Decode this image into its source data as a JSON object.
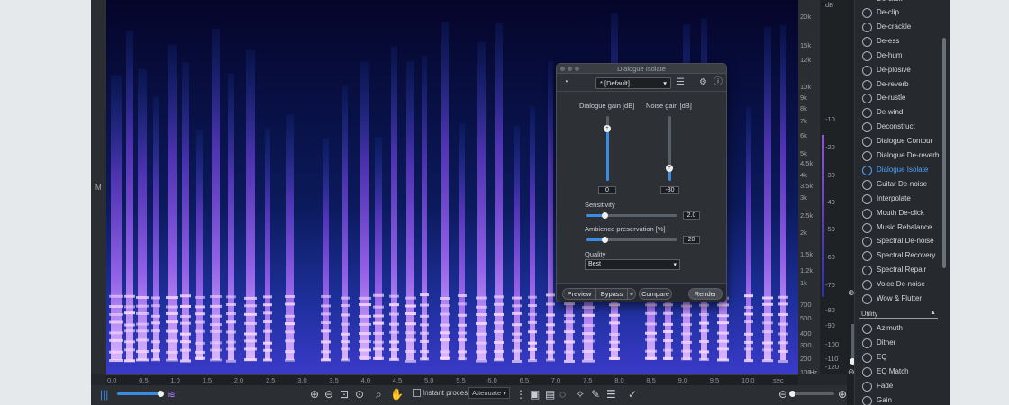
{
  "spectrogram": {
    "channel_label": "M",
    "freq_ticks": [
      "20k",
      "15k",
      "12k",
      "10k",
      "9k",
      "8k",
      "7k",
      "6k",
      "5k",
      "4.5k",
      "4k",
      "3.5k",
      "3k",
      "2.5k",
      "2k",
      "1.5k",
      "1.2k",
      "1k",
      "700",
      "500",
      "400",
      "300",
      "200",
      "100",
      "Hz"
    ],
    "db_ticks": [
      "dB",
      "-10",
      "-20",
      "-30",
      "-40",
      "-50",
      "-60",
      "-70",
      "-80",
      "-90",
      "-100",
      "-110",
      "-120"
    ],
    "time_ticks": [
      "0.0",
      "0.5",
      "1.0",
      "1.5",
      "2.0",
      "2.5",
      "3.0",
      "3.5",
      "4.0",
      "4.5",
      "5.0",
      "5.5",
      "6.0",
      "6.5",
      "7.0",
      "7.5",
      "8.0",
      "8.5",
      "9.0",
      "9.5",
      "10.0",
      "sec"
    ]
  },
  "toolbar": {
    "instant_process_label": "Instant process",
    "attenuate_value": "Attenuate",
    "icons": [
      "waveform-icon",
      "zoom-in-icon",
      "zoom-out-icon",
      "zoom-selection-icon",
      "zoom-fit-icon",
      "magnify-icon",
      "hand-icon",
      "time-select-icon",
      "freq-select-icon",
      "rect-select-icon",
      "lasso-icon",
      "magic-wand-icon",
      "brush-icon",
      "harmonic-icon",
      "zoom-out-horizontal-icon",
      "zoom-in-horizontal-icon"
    ]
  },
  "dialog": {
    "title": "Dialogue Isolate",
    "preset": "* [Default]",
    "dialogue_gain": {
      "label": "Dialogue gain [dB]",
      "value": "0",
      "level": 0.8
    },
    "noise_gain": {
      "label": "Noise gain [dB]",
      "value": "-30",
      "level": 0.2
    },
    "sensitivity": {
      "label": "Sensitivity",
      "value": "2.0",
      "level": 0.2
    },
    "ambience": {
      "label": "Ambience preservation [%]",
      "value": "20",
      "level": 0.2
    },
    "quality": {
      "label": "Quality",
      "value": "Best"
    },
    "buttons": {
      "preview": "Preview",
      "bypass": "Bypass",
      "plus": "+",
      "compare": "Compare",
      "render": "Render"
    }
  },
  "modules": {
    "items": [
      {
        "label": "De-clip",
        "icon": "clip-icon"
      },
      {
        "label": "De-crackle",
        "icon": "crackle-icon"
      },
      {
        "label": "De-ess",
        "icon": "ess-icon"
      },
      {
        "label": "De-hum",
        "icon": "hum-icon"
      },
      {
        "label": "De-plosive",
        "icon": "plosive-icon"
      },
      {
        "label": "De-reverb",
        "icon": "reverb-icon"
      },
      {
        "label": "De-rustle",
        "icon": "rustle-icon"
      },
      {
        "label": "De-wind",
        "icon": "wind-icon"
      },
      {
        "label": "Deconstruct",
        "icon": "deconstruct-icon"
      },
      {
        "label": "Dialogue Contour",
        "icon": "contour-icon"
      },
      {
        "label": "Dialogue De-reverb",
        "icon": "dialogue-reverb-icon"
      },
      {
        "label": "Dialogue Isolate",
        "icon": "dialogue-isolate-icon",
        "active": true
      },
      {
        "label": "Guitar De-noise",
        "icon": "guitar-icon"
      },
      {
        "label": "Interpolate",
        "icon": "interpolate-icon"
      },
      {
        "label": "Mouth De-click",
        "icon": "mouth-icon"
      },
      {
        "label": "Music Rebalance",
        "icon": "rebalance-icon"
      },
      {
        "label": "Spectral De-noise",
        "icon": "spectral-denoise-icon"
      },
      {
        "label": "Spectral Recovery",
        "icon": "recovery-icon"
      },
      {
        "label": "Spectral Repair",
        "icon": "repair-icon"
      },
      {
        "label": "Voice De-noise",
        "icon": "voice-icon"
      },
      {
        "label": "Wow & Flutter",
        "icon": "wow-icon"
      }
    ],
    "utility_label": "Utility",
    "utility_items": [
      {
        "label": "Azimuth",
        "icon": "azimuth-icon"
      },
      {
        "label": "Dither",
        "icon": "dither-icon"
      },
      {
        "label": "EQ",
        "icon": "eq-icon"
      },
      {
        "label": "EQ Match",
        "icon": "eq-match-icon"
      },
      {
        "label": "Fade",
        "icon": "fade-icon"
      },
      {
        "label": "Gain",
        "icon": "gain-icon"
      }
    ],
    "top_partial": "De-click"
  },
  "colors": {
    "accent": "#3a8be6",
    "active_module": "#4aa3ff",
    "spectro_bg": "#06062a"
  }
}
